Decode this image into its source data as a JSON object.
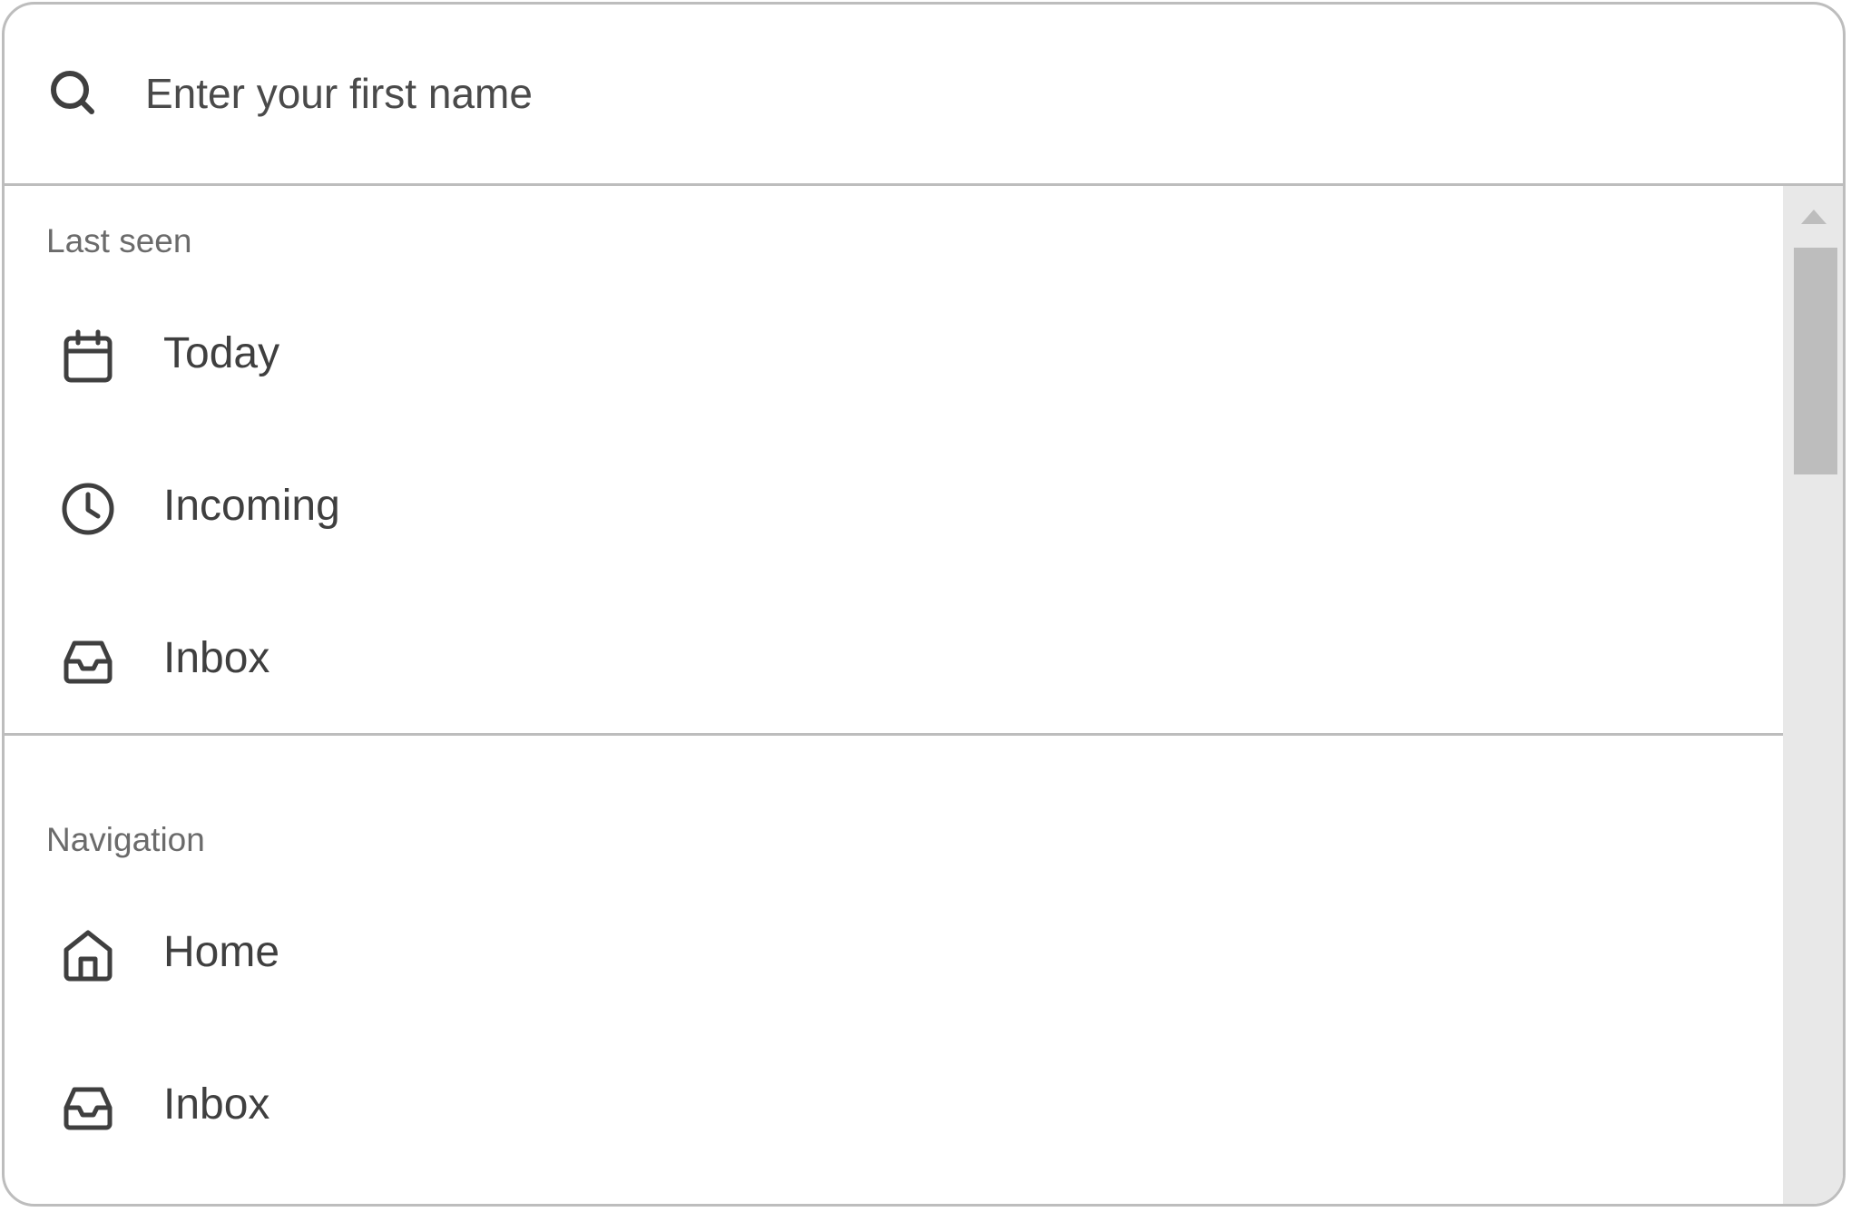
{
  "search": {
    "placeholder": "Enter your first name",
    "icon": "search-icon"
  },
  "sections": {
    "last_seen": {
      "header": "Last seen",
      "items": [
        {
          "label": "Today",
          "icon": "calendar-icon"
        },
        {
          "label": "Incoming",
          "icon": "clock-icon"
        },
        {
          "label": "Inbox",
          "icon": "inbox-icon"
        }
      ]
    },
    "navigation": {
      "header": "Navigation",
      "items": [
        {
          "label": "Home",
          "icon": "home-icon"
        },
        {
          "label": "Inbox",
          "icon": "inbox-icon"
        }
      ]
    }
  },
  "colors": {
    "border": "#bdbdbd",
    "text": "#3f3f3f",
    "section_header": "#6b6b6b",
    "scrollbar_track": "#e8e8e8"
  }
}
